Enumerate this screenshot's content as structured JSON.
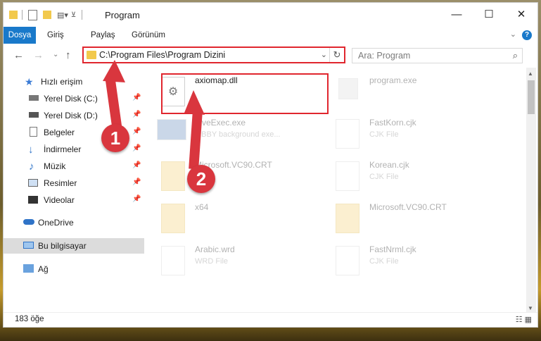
{
  "window": {
    "title": "Program"
  },
  "ribbon": {
    "tabs": [
      "Dosya",
      "Giriş",
      "Paylaş",
      "Görünüm"
    ]
  },
  "nav": {
    "address": "C:\\Program Files\\Program Dizini",
    "search_placeholder": "Ara: Program"
  },
  "sidebar": {
    "items": [
      {
        "label": "Hızlı erişim",
        "icon": "star-icon"
      },
      {
        "label": "Yerel Disk (C:)",
        "icon": "drive-icon"
      },
      {
        "label": "Yerel Disk (D:)",
        "icon": "drive-icon"
      },
      {
        "label": "Belgeler",
        "icon": "document-icon"
      },
      {
        "label": "İndirmeler",
        "icon": "download-icon"
      },
      {
        "label": "Müzik",
        "icon": "music-icon"
      },
      {
        "label": "Resimler",
        "icon": "pictures-icon"
      },
      {
        "label": "Videolar",
        "icon": "video-icon"
      },
      {
        "label": "OneDrive",
        "icon": "cloud-icon"
      },
      {
        "label": "Bu bilgisayar",
        "icon": "computer-icon"
      },
      {
        "label": "Ağ",
        "icon": "network-icon"
      }
    ]
  },
  "files": [
    {
      "name": "axiomap.dll",
      "type": "",
      "icon": "dll-icon"
    },
    {
      "name": "program.exe",
      "type": "",
      "icon": "exe-icon"
    },
    {
      "name": "...veExec.exe",
      "type": "...BBY background exe...",
      "icon": "exe-icon"
    },
    {
      "name": "FastKorn.cjk",
      "type": "CJK File",
      "icon": "file-icon"
    },
    {
      "name": "Microsoft.VC90.CRT",
      "type": "",
      "icon": "folder-icon"
    },
    {
      "name": "Korean.cjk",
      "type": "CJK File",
      "icon": "file-icon"
    },
    {
      "name": "x64",
      "type": "",
      "icon": "folder-icon"
    },
    {
      "name": "Microsoft.VC90.CRT",
      "type": "",
      "icon": "folder-icon"
    },
    {
      "name": "Arabic.wrd",
      "type": "WRD File",
      "icon": "file-icon"
    },
    {
      "name": "FastNrml.cjk",
      "type": "CJK File",
      "icon": "file-icon"
    }
  ],
  "status": {
    "count": "183 öğe"
  },
  "annotations": {
    "one": "1",
    "two": "2"
  },
  "colors": {
    "accent": "#1979ca",
    "highlight": "#e0262e",
    "callout": "#d9363e"
  }
}
